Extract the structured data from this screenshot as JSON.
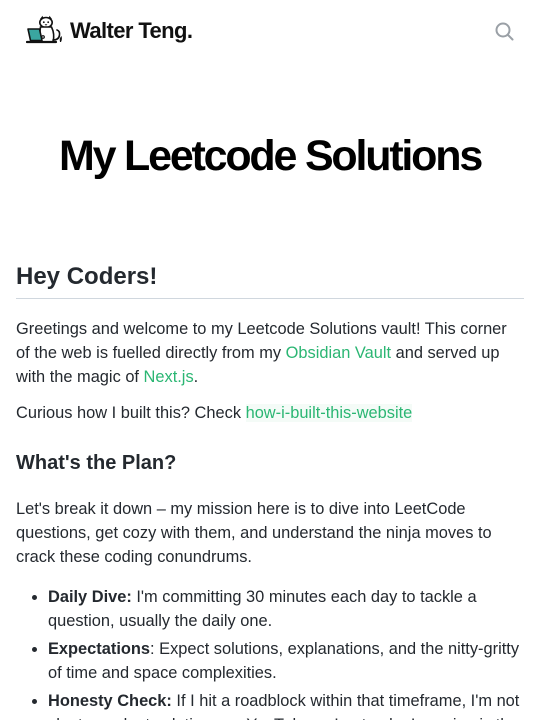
{
  "header": {
    "brand_name": "Walter Teng.",
    "logo_icon": "cat-laptop-icon",
    "search_icon": "search-icon"
  },
  "hero": {
    "title": "My Leetcode Solutions"
  },
  "article": {
    "heading": "Hey Coders!",
    "intro": {
      "text_1": "Greetings and welcome to my Leetcode Solutions vault! This corner of the web is fuelled directly from my ",
      "link_1": "Obsidian Vault",
      "text_2": " and served up with the magic of ",
      "link_2": "Next.js",
      "text_3": "."
    },
    "built": {
      "text": "Curious how I built this? Check ",
      "link": "how-i-built-this-website"
    },
    "plan_heading": "What's the Plan?",
    "plan_intro": "Let's break it down – my mission here is to dive into LeetCode questions, get cozy with them, and understand the ninja moves to crack these coding conundrums.",
    "plan_items": [
      {
        "bold": "Daily Dive:",
        "text": " I'm committing 30 minutes each day to tackle a question, usually the daily one."
      },
      {
        "bold": "Expectations",
        "text": ": Expect solutions, explanations, and the nitty-gritty of time and space complexities."
      },
      {
        "bold": "Honesty Check:",
        "text": " If I hit a roadblock within that timeframe, I'm not shy to peek at solutions on YouTube or Leetcode. Learning is the"
      }
    ]
  },
  "colors": {
    "link": "#2bb673",
    "text": "#24292f",
    "divider": "#d0d7de"
  }
}
